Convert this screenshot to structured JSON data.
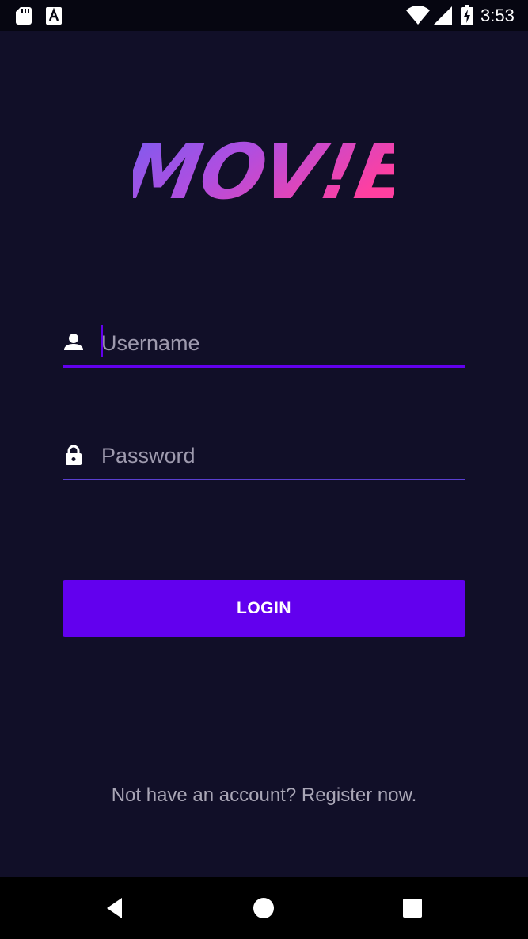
{
  "status_bar": {
    "time": "3:53",
    "icons": [
      "sd-card-icon",
      "a11y-icon",
      "wifi-icon",
      "signal-icon",
      "battery-charging-icon"
    ]
  },
  "logo": {
    "text": "MOV!E",
    "gradient_start": "#7b5cf0",
    "gradient_end": "#ff3fa0"
  },
  "form": {
    "username": {
      "icon": "person-icon",
      "placeholder": "Username",
      "value": ""
    },
    "password": {
      "icon": "lock-icon",
      "placeholder": "Password",
      "value": ""
    },
    "login_label": "LOGIN"
  },
  "register_text": "Not have an account? Register now.",
  "nav_bar": {
    "buttons": [
      "back-icon",
      "home-icon",
      "recents-icon"
    ]
  },
  "colors": {
    "background": "#110f28",
    "accent": "#6200ee",
    "placeholder": "#9e9aae",
    "muted_text": "#a9a6b6"
  }
}
